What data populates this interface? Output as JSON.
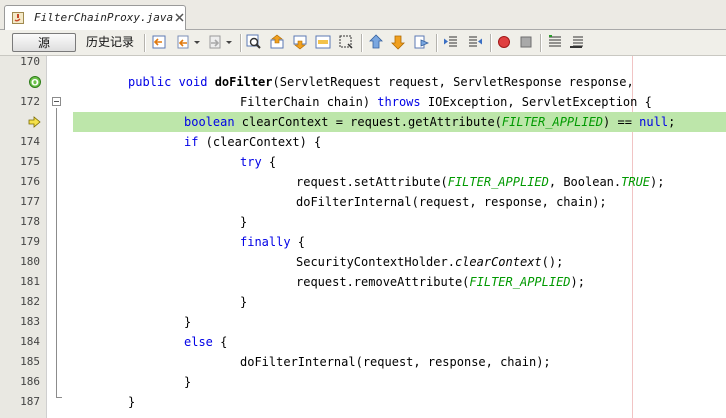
{
  "tab": {
    "title": "FilterChainProxy.java",
    "icon": "java-file-icon",
    "close_icon": "close-icon"
  },
  "toolbar": {
    "source_label": "源",
    "history_label": "历史记录",
    "icons": [
      "last-edit-icon",
      "back-icon",
      "forward-icon",
      "find-selection-icon",
      "find-previous-icon",
      "find-next-icon",
      "toggle-highlight-icon",
      "toggle-rectangular-selection-icon",
      "previous-bookmark-icon",
      "next-bookmark-icon",
      "toggle-bookmark-icon",
      "shift-left-icon",
      "shift-right-icon",
      "start-macro-icon",
      "stop-macro-icon",
      "comment-icon",
      "uncomment-icon"
    ]
  },
  "editor": {
    "lines": [
      {
        "num": "170",
        "tokens": [
          {
            "t": "",
            "c": ""
          }
        ]
      },
      {
        "num": "",
        "marker": "override-icon",
        "tokens": [
          {
            "t": "public void ",
            "c": "kw"
          },
          {
            "t": "doFilter",
            "c": "fn"
          },
          {
            "t": "(ServletRequest request, ServletResponse response,",
            "c": ""
          }
        ]
      },
      {
        "num": "172",
        "fold": true,
        "tokens": [
          {
            "t": "FilterChain chain) ",
            "c": ""
          },
          {
            "t": "throws",
            "c": "kw"
          },
          {
            "t": " IOException, ServletException {",
            "c": ""
          }
        ]
      },
      {
        "num": "",
        "marker": "current-line-arrow-icon",
        "current": true,
        "tokens": [
          {
            "t": "boolean",
            "c": "kw"
          },
          {
            "t": " clearContext = request.getAttribute(",
            "c": ""
          },
          {
            "t": "FILTER_APPLIED",
            "c": "const"
          },
          {
            "t": ") == ",
            "c": ""
          },
          {
            "t": "null",
            "c": "kw"
          },
          {
            "t": ";",
            "c": ""
          }
        ]
      },
      {
        "num": "174",
        "tokens": [
          {
            "t": "if",
            "c": "kw"
          },
          {
            "t": " (clearContext) {",
            "c": ""
          }
        ]
      },
      {
        "num": "175",
        "tokens": [
          {
            "t": "try",
            "c": "kw"
          },
          {
            "t": " {",
            "c": ""
          }
        ]
      },
      {
        "num": "176",
        "tokens": [
          {
            "t": "request.setAttribute(",
            "c": ""
          },
          {
            "t": "FILTER_APPLIED",
            "c": "const"
          },
          {
            "t": ", Boolean.",
            "c": ""
          },
          {
            "t": "TRUE",
            "c": "const"
          },
          {
            "t": ");",
            "c": ""
          }
        ]
      },
      {
        "num": "177",
        "tokens": [
          {
            "t": "doFilterInternal(request, response, chain);",
            "c": ""
          }
        ]
      },
      {
        "num": "178",
        "tokens": [
          {
            "t": "}",
            "c": ""
          }
        ]
      },
      {
        "num": "179",
        "tokens": [
          {
            "t": "finally",
            "c": "kw"
          },
          {
            "t": " {",
            "c": ""
          }
        ]
      },
      {
        "num": "180",
        "tokens": [
          {
            "t": "SecurityContextHolder.",
            "c": ""
          },
          {
            "t": "clearContext",
            "c": "static-m"
          },
          {
            "t": "();",
            "c": ""
          }
        ]
      },
      {
        "num": "181",
        "tokens": [
          {
            "t": "request.removeAttribute(",
            "c": ""
          },
          {
            "t": "FILTER_APPLIED",
            "c": "const"
          },
          {
            "t": ");",
            "c": ""
          }
        ]
      },
      {
        "num": "182",
        "tokens": [
          {
            "t": "}",
            "c": ""
          }
        ]
      },
      {
        "num": "183",
        "tokens": [
          {
            "t": "}",
            "c": ""
          }
        ]
      },
      {
        "num": "184",
        "tokens": [
          {
            "t": "else",
            "c": "kw"
          },
          {
            "t": " {",
            "c": ""
          }
        ]
      },
      {
        "num": "185",
        "tokens": [
          {
            "t": "doFilterInternal(request, response, chain);",
            "c": ""
          }
        ]
      },
      {
        "num": "186",
        "tokens": [
          {
            "t": "}",
            "c": ""
          }
        ]
      },
      {
        "num": "187",
        "tokens": [
          {
            "t": "}",
            "c": ""
          }
        ]
      }
    ]
  },
  "colors": {
    "keyword": "#0000e6",
    "constant": "#009900",
    "current_line": "#bde6aa",
    "right_margin": "#f1c4c4"
  }
}
